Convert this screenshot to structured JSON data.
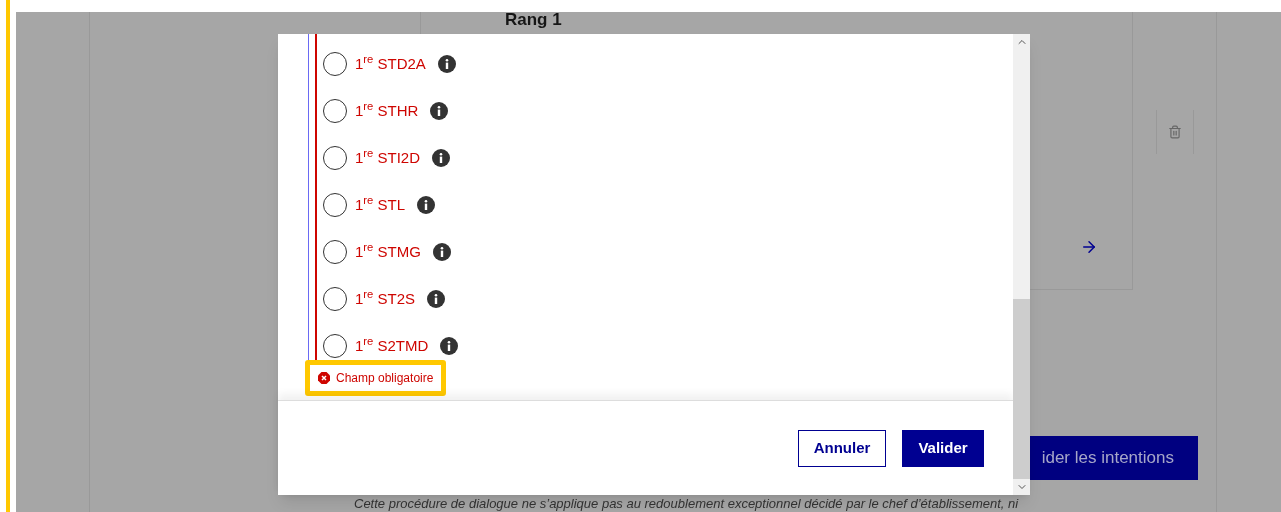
{
  "background": {
    "heading": "Rang 1",
    "submit_button": "ider les intentions",
    "note": "Cette procédure de dialogue ne s’applique pas au redoublement exceptionnel décidé par le chef d’établissement, ni"
  },
  "dialog": {
    "invalid": true,
    "options": [
      {
        "label": "1$^{re}$ STD2A",
        "selected": false
      },
      {
        "label": "1$^{re}$ STHR",
        "selected": false
      },
      {
        "label": "1$^{re}$ STI2D",
        "selected": false
      },
      {
        "label": "1$^{re}$ STL",
        "selected": false
      },
      {
        "label": "1$^{re}$ STMG",
        "selected": false
      },
      {
        "label": "1$^{re}$ ST2S",
        "selected": false
      },
      {
        "label": "1$^{re}$ S2TMD",
        "selected": false
      }
    ],
    "error": "Champ obligatoire",
    "buttons": [
      {
        "label": "Annuler",
        "kind": "secondary"
      },
      {
        "label": "Valider",
        "kind": "primary"
      }
    ]
  }
}
